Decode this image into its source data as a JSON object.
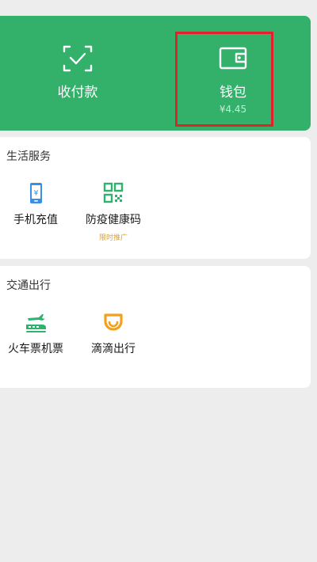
{
  "top_card": {
    "pay": {
      "label": "收付款"
    },
    "wallet": {
      "label": "钱包",
      "balance": "¥4.45"
    }
  },
  "life_services": {
    "title": "生活服务",
    "items": [
      {
        "label": "手机充值",
        "icon": "phone-recharge-icon"
      },
      {
        "label": "防疫健康码",
        "tag": "限时推广",
        "icon": "qr-code-icon"
      }
    ]
  },
  "traffic": {
    "title": "交通出行",
    "items": [
      {
        "label": "火车票机票",
        "icon": "train-plane-icon"
      },
      {
        "label": "滴滴出行",
        "icon": "didi-icon"
      }
    ]
  },
  "colors": {
    "green": "#33b06a",
    "highlight_red": "#e0222d",
    "phone_blue": "#3a8ee6",
    "qr_green": "#2db36b",
    "didi_orange": "#f2a01d"
  }
}
